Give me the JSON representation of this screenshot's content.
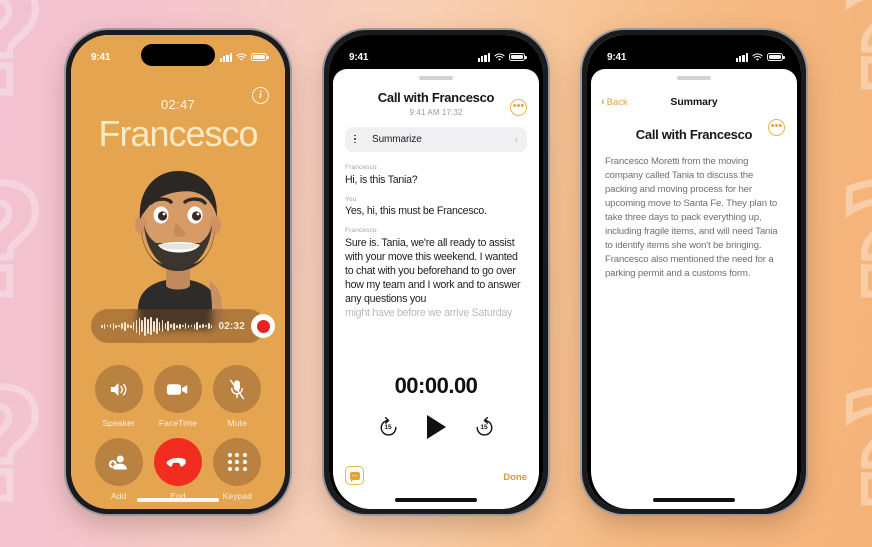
{
  "background": {
    "gradient_from": "#f2c2d2",
    "gradient_to": "#f4b277",
    "deco_glyph": "?"
  },
  "phone_call": {
    "status_bar": {
      "time": "9:41",
      "icons": [
        "cellular-icon",
        "wifi-icon",
        "battery-icon"
      ]
    },
    "info_button": "i",
    "timer": "02:47",
    "caller_name": "Francesco",
    "recorder": {
      "elapsed": "02:32",
      "record_button": "record-button"
    },
    "controls": [
      {
        "label": "Speaker",
        "icon": "speaker-icon"
      },
      {
        "label": "FaceTime",
        "icon": "video-camera-icon"
      },
      {
        "label": "Mute",
        "icon": "microphone-muted-icon"
      },
      {
        "label": "Add",
        "icon": "add-person-icon"
      },
      {
        "label": "End",
        "icon": "end-call-icon"
      },
      {
        "label": "Keypad",
        "icon": "keypad-icon"
      }
    ]
  },
  "phone_transcript": {
    "status_bar": {
      "time": "9:41"
    },
    "title": "Call with Francesco",
    "subtitle": "9:41 AM  17:32",
    "more_button": "•••",
    "summarize": {
      "label": "Summarize",
      "chevron": "›"
    },
    "messages": [
      {
        "speaker": "Francesco",
        "text": "Hi, is this Tania?",
        "dim": false
      },
      {
        "speaker": "You",
        "text": "Yes, hi, this must be Francesco.",
        "dim": false
      },
      {
        "speaker": "Francesco",
        "text": "Sure is. Tania, we're all ready to assist with your move this weekend. I wanted to chat with you beforehand to go over how my team and I work and to answer any questions you",
        "dim": false
      },
      {
        "speaker": "",
        "text": "might have before we arrive Saturday",
        "dim": true
      }
    ],
    "player": {
      "time": "00:00.00",
      "skip_back": "15",
      "skip_forward": "15",
      "play": "play-icon"
    },
    "message_button": "message-icon",
    "done_button": "Done"
  },
  "phone_summary": {
    "status_bar": {
      "time": "9:41"
    },
    "back_label": "Back",
    "nav_title": "Summary",
    "more_button": "•••",
    "title": "Call with Francesco",
    "body": "Francesco Moretti from the moving company called Tania to discuss the packing and moving process for her upcoming move to Santa Fe. They plan to take three days to pack everything up, including fragile items, and will need Tania to identify items she won't be bringing. Francesco also mentioned the need for a parking permit and a customs form."
  }
}
